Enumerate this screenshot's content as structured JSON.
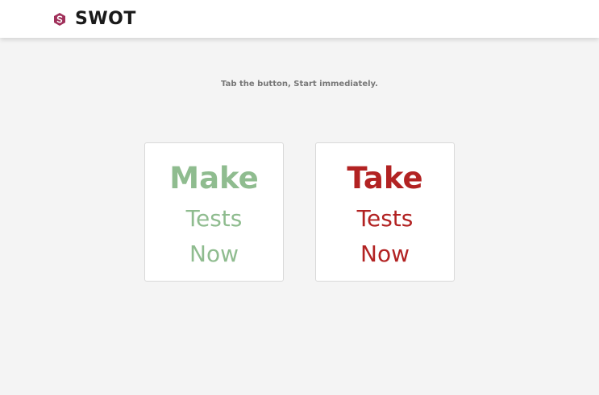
{
  "header": {
    "brand_name": "SWOT",
    "logo_icon": "hexagon-s-logo-icon",
    "logo_color": "#a0305a"
  },
  "main": {
    "tagline": "Tab the button, Start immediately.",
    "cards": [
      {
        "line1": "Make",
        "line2": "Tests",
        "line3": "Now",
        "color": "#8fbc8f"
      },
      {
        "line1": "Take",
        "line2": "Tests",
        "line3": "Now",
        "color": "#b22222"
      }
    ]
  }
}
